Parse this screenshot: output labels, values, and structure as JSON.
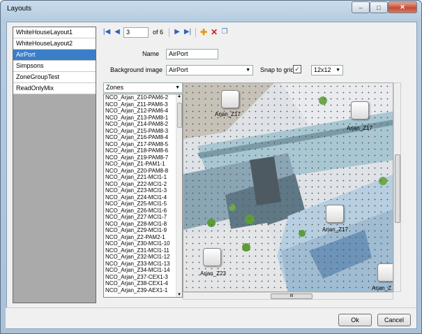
{
  "window": {
    "title": "Layouts",
    "btn_min": "–",
    "btn_max": "□",
    "btn_close": "✕"
  },
  "layouts": [
    "WhiteHouseLayout1",
    "WhiteHouseLayout2",
    "AirPort",
    "Simpsons",
    "ZoneGroupTest",
    "ReadOnlyMix"
  ],
  "nav": {
    "page": "3",
    "of_label": "of 6"
  },
  "form": {
    "name_label": "Name",
    "name_value": "AirPort",
    "bg_label": "Background image",
    "bg_value": "AirPort",
    "snap_label": "Snap to grid",
    "snap_checked": true,
    "grid_value": "12x12",
    "zones_value": "Zones"
  },
  "zones": [
    "NCO_Arjan_Z10-PAM6-2",
    "NCO_Arjan_Z11-PAM6-3",
    "NCO_Arjan_Z12-PAM6-4",
    "NCO_Arjan_Z13-PAM8-1",
    "NCO_Arjan_Z14-PAM8-2",
    "NCO_Arjan_Z15-PAM8-3",
    "NCO_Arjan_Z16-PAM8-4",
    "NCO_Arjan_Z17-PAM8-5",
    "NCO_Arjan_Z18-PAM8-6",
    "NCO_Arjan_Z19-PAM8-7",
    "NCO_Arjan_Z1-PAM1-1",
    "NCO_Arjan_Z20-PAM8-8",
    "NCO_Arjan_Z21-MCI1-1",
    "NCO_Arjan_Z22-MCI1-2",
    "NCO_Arjan_Z23-MCI1-3",
    "NCO_Arjan_Z24-MCI1-4",
    "NCO_Arjan_Z25-MCI1-5",
    "NCO_Arjan_Z26-MCI1-6",
    "NCO_Arjan_Z27-MCI1-7",
    "NCO_Arjan_Z28-MCI1-8",
    "NCO_Arjan_Z29-MCI1-9",
    "NCO_Arjan_Z2-PAM2-1",
    "NCO_Arjan_Z30-MCI1-10",
    "NCO_Arjan_Z31-MCI1-11",
    "NCO_Arjan_Z32-MCI1-12",
    "NCO_Arjan_Z33-MCI1-13",
    "NCO_Arjan_Z34-MCI1-14",
    "NCO_Arjan_Z37-CEX1-3",
    "NCO_Arjan_Z38-CEX1-4",
    "NCO_Arjan_Z39-AEX1-1"
  ],
  "canvas_zones": {
    "z1": "Arjan_Z17",
    "z2": "Arjan_Z17",
    "z3": "Arjan_Z17",
    "z4": "Arjan_Z23",
    "z5": "Arjan_Z"
  },
  "buttons": {
    "ok": "Ok",
    "cancel": "Cancel"
  },
  "scroll": {
    "grip": "III",
    "vgrip": "≡"
  }
}
